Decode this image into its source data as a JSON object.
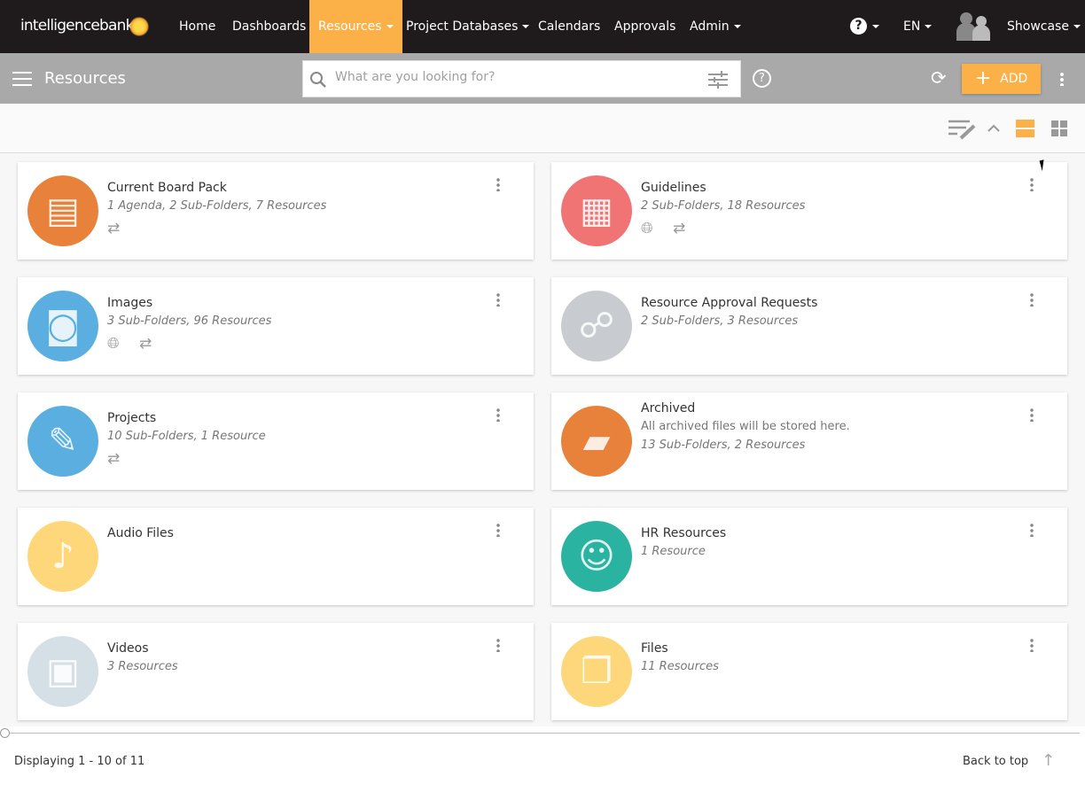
{
  "brand": {
    "logo_text": "intelligencebank"
  },
  "nav": [
    {
      "label": "Home",
      "caret": false
    },
    {
      "label": "Dashboards",
      "caret": false
    },
    {
      "label": "Resources",
      "caret": true,
      "active": true
    },
    {
      "label": "Project Databases",
      "caret": true
    },
    {
      "label": "Calendars",
      "caret": false
    },
    {
      "label": "Approvals",
      "caret": false
    },
    {
      "label": "Admin",
      "caret": true
    }
  ],
  "nav_right": {
    "help_icon": "question-circle-icon",
    "language": "EN",
    "user": "Showcase"
  },
  "toolbar": {
    "title": "Resources",
    "search_placeholder": "What are you looking for?",
    "add_label": "ADD"
  },
  "colors": {
    "accent": "#fbb148",
    "nav_bg": "#1f1b1c",
    "toolbar_bg": "#a9a9a9"
  },
  "cards": [
    {
      "title": "Current Board Pack",
      "lines": [
        "1 Agenda, 2 Sub-Folders, 7 Resources"
      ],
      "icons": [
        "repeat-icon"
      ],
      "icon": "notepad-icon",
      "color": "#e8813a"
    },
    {
      "title": "Guidelines",
      "lines": [
        "2 Sub-Folders, 18 Resources"
      ],
      "icons": [
        "globe-icon",
        "repeat-icon"
      ],
      "icon": "color-swatch-icon",
      "color": "#f07474"
    },
    {
      "title": "Images",
      "lines": [
        "3 Sub-Folders, 96 Resources"
      ],
      "icons": [
        "globe-icon",
        "repeat-icon"
      ],
      "icon": "camera-icon",
      "color": "#5aafe0"
    },
    {
      "title": "Resource Approval Requests",
      "lines": [
        "2 Sub-Folders, 3 Resources"
      ],
      "icons": [],
      "icon": "org-chart-icon",
      "color": "#c8ccd0"
    },
    {
      "title": "Projects",
      "lines": [
        "10 Sub-Folders, 1 Resource"
      ],
      "icons": [
        "repeat-icon"
      ],
      "icon": "tablet-pen-icon",
      "color": "#5aafe0"
    },
    {
      "title": "Archived",
      "description": "All archived files will be stored here.",
      "lines": [
        "13 Sub-Folders, 2 Resources"
      ],
      "icons": [],
      "icon": "folder-icon",
      "color": "#e8813a"
    },
    {
      "title": "Audio Files",
      "lines": [],
      "icons": [],
      "icon": "music-note-icon",
      "color": "#fdd77a"
    },
    {
      "title": "HR Resources",
      "lines": [
        "1 Resource"
      ],
      "icons": [],
      "icon": "person-reading-icon",
      "color": "#2ab3a0"
    },
    {
      "title": "Videos",
      "lines": [
        "3 Resources"
      ],
      "icons": [],
      "icon": "film-icon",
      "color": "#d5e0e6"
    },
    {
      "title": "Files",
      "lines": [
        "11 Resources"
      ],
      "icons": [],
      "icon": "documents-icon",
      "color": "#fdd77a"
    }
  ],
  "footer": {
    "displaying": "Displaying 1 - 10 of 11",
    "back_to_top": "Back to top"
  }
}
